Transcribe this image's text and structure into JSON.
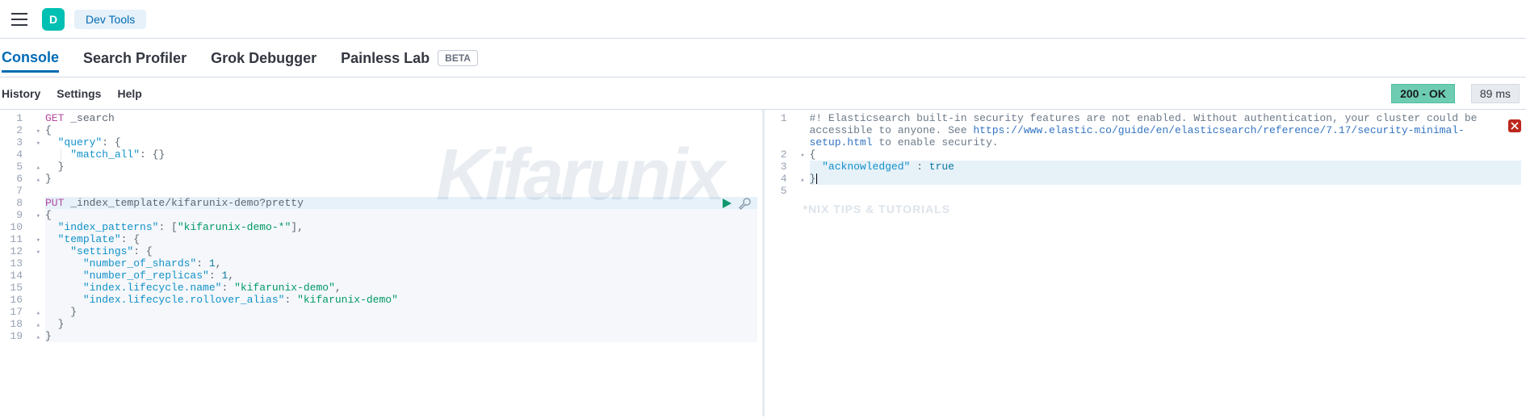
{
  "header": {
    "app_letter": "D",
    "breadcrumb": "Dev Tools"
  },
  "tabs": [
    {
      "label": "Console",
      "active": true
    },
    {
      "label": "Search Profiler",
      "active": false
    },
    {
      "label": "Grok Debugger",
      "active": false
    },
    {
      "label": "Painless Lab",
      "active": false,
      "beta": "BETA"
    }
  ],
  "menubar": {
    "history": "History",
    "settings": "Settings",
    "help": "Help"
  },
  "status": {
    "code_text": "200 - OK",
    "timing": "89 ms"
  },
  "request": {
    "lines": [
      {
        "n": 1,
        "fold": "",
        "seg": [
          {
            "c": "tok-method",
            "t": "GET"
          },
          {
            "c": "",
            "t": " "
          },
          {
            "c": "tok-path",
            "t": "_search"
          }
        ]
      },
      {
        "n": 2,
        "fold": "▾",
        "seg": [
          {
            "c": "tok-brace",
            "t": "{"
          }
        ]
      },
      {
        "n": 3,
        "fold": "▾",
        "seg": [
          {
            "c": "",
            "t": "  "
          },
          {
            "c": "tok-key",
            "t": "\"query\""
          },
          {
            "c": "tok-brace",
            "t": ": {"
          }
        ]
      },
      {
        "n": 4,
        "fold": "",
        "seg": [
          {
            "c": "guide",
            "t": "  │ "
          },
          {
            "c": "tok-key",
            "t": "\"match_all\""
          },
          {
            "c": "tok-brace",
            "t": ": {}"
          }
        ]
      },
      {
        "n": 5,
        "fold": "▴",
        "seg": [
          {
            "c": "",
            "t": "  "
          },
          {
            "c": "tok-brace",
            "t": "}"
          }
        ]
      },
      {
        "n": 6,
        "fold": "▴",
        "seg": [
          {
            "c": "tok-brace",
            "t": "}"
          }
        ]
      },
      {
        "n": 7,
        "fold": "",
        "seg": []
      },
      {
        "n": 8,
        "fold": "",
        "hl": true,
        "seg": [
          {
            "c": "tok-method",
            "t": "PUT"
          },
          {
            "c": "",
            "t": " "
          },
          {
            "c": "tok-path",
            "t": "_index_template/kifarunix-demo?pretty"
          }
        ]
      },
      {
        "n": 9,
        "fold": "▾",
        "dim": true,
        "seg": [
          {
            "c": "tok-brace",
            "t": "{"
          }
        ]
      },
      {
        "n": 10,
        "fold": "",
        "dim": true,
        "seg": [
          {
            "c": "",
            "t": "  "
          },
          {
            "c": "tok-key",
            "t": "\"index_patterns\""
          },
          {
            "c": "tok-brace",
            "t": ": ["
          },
          {
            "c": "tok-str",
            "t": "\"kifarunix-demo-*\""
          },
          {
            "c": "tok-brace",
            "t": "],"
          }
        ]
      },
      {
        "n": 11,
        "fold": "▾",
        "dim": true,
        "seg": [
          {
            "c": "",
            "t": "  "
          },
          {
            "c": "tok-key",
            "t": "\"template\""
          },
          {
            "c": "tok-brace",
            "t": ": {"
          }
        ]
      },
      {
        "n": 12,
        "fold": "▾",
        "dim": true,
        "seg": [
          {
            "c": "",
            "t": "    "
          },
          {
            "c": "tok-key",
            "t": "\"settings\""
          },
          {
            "c": "tok-brace",
            "t": ": {"
          }
        ]
      },
      {
        "n": 13,
        "fold": "",
        "dim": true,
        "seg": [
          {
            "c": "",
            "t": "      "
          },
          {
            "c": "tok-key",
            "t": "\"number_of_shards\""
          },
          {
            "c": "tok-brace",
            "t": ": "
          },
          {
            "c": "tok-num",
            "t": "1"
          },
          {
            "c": "tok-brace",
            "t": ","
          }
        ]
      },
      {
        "n": 14,
        "fold": "",
        "dim": true,
        "seg": [
          {
            "c": "",
            "t": "      "
          },
          {
            "c": "tok-key",
            "t": "\"number_of_replicas\""
          },
          {
            "c": "tok-brace",
            "t": ": "
          },
          {
            "c": "tok-num",
            "t": "1"
          },
          {
            "c": "tok-brace",
            "t": ","
          }
        ]
      },
      {
        "n": 15,
        "fold": "",
        "dim": true,
        "seg": [
          {
            "c": "",
            "t": "      "
          },
          {
            "c": "tok-key",
            "t": "\"index.lifecycle.name\""
          },
          {
            "c": "tok-brace",
            "t": ": "
          },
          {
            "c": "tok-str",
            "t": "\"kifarunix-demo\""
          },
          {
            "c": "tok-brace",
            "t": ","
          }
        ]
      },
      {
        "n": 16,
        "fold": "",
        "dim": true,
        "seg": [
          {
            "c": "",
            "t": "      "
          },
          {
            "c": "tok-key",
            "t": "\"index.lifecycle.rollover_alias\""
          },
          {
            "c": "tok-brace",
            "t": ": "
          },
          {
            "c": "tok-str",
            "t": "\"kifarunix-demo\""
          }
        ]
      },
      {
        "n": 17,
        "fold": "▴",
        "dim": true,
        "seg": [
          {
            "c": "",
            "t": "    "
          },
          {
            "c": "tok-brace",
            "t": "}"
          }
        ]
      },
      {
        "n": 18,
        "fold": "▴",
        "dim": true,
        "seg": [
          {
            "c": "",
            "t": "  "
          },
          {
            "c": "tok-brace",
            "t": "}"
          }
        ]
      },
      {
        "n": 19,
        "fold": "▴",
        "dim": true,
        "seg": [
          {
            "c": "tok-brace",
            "t": "}"
          }
        ]
      }
    ]
  },
  "response": {
    "warning_prefix": "#! ",
    "warning_text": "Elasticsearch built-in security features are not enabled. Without authentication, your cluster could be accessible to anyone. See ",
    "warning_url": "https://www.elastic.co/guide/en/elasticsearch/reference/7.17/security-minimal-setup.html",
    "warning_suffix": " to enable security.",
    "lines": [
      {
        "n": 2,
        "fold": "▾",
        "seg": [
          {
            "c": "tok-brace",
            "t": "{"
          }
        ]
      },
      {
        "n": 3,
        "fold": "",
        "hl": true,
        "seg": [
          {
            "c": "",
            "t": "  "
          },
          {
            "c": "tok-key",
            "t": "\"acknowledged\""
          },
          {
            "c": "tok-brace",
            "t": " : "
          },
          {
            "c": "tok-bool",
            "t": "true"
          }
        ]
      },
      {
        "n": 4,
        "fold": "▴",
        "hl": true,
        "seg": [
          {
            "c": "tok-brace",
            "t": "}"
          }
        ],
        "cursor": true
      },
      {
        "n": 5,
        "fold": "",
        "seg": []
      }
    ]
  },
  "watermark": {
    "brand": "Kifarunix",
    "tagline": "*NIX TIPS & TUTORIALS"
  }
}
